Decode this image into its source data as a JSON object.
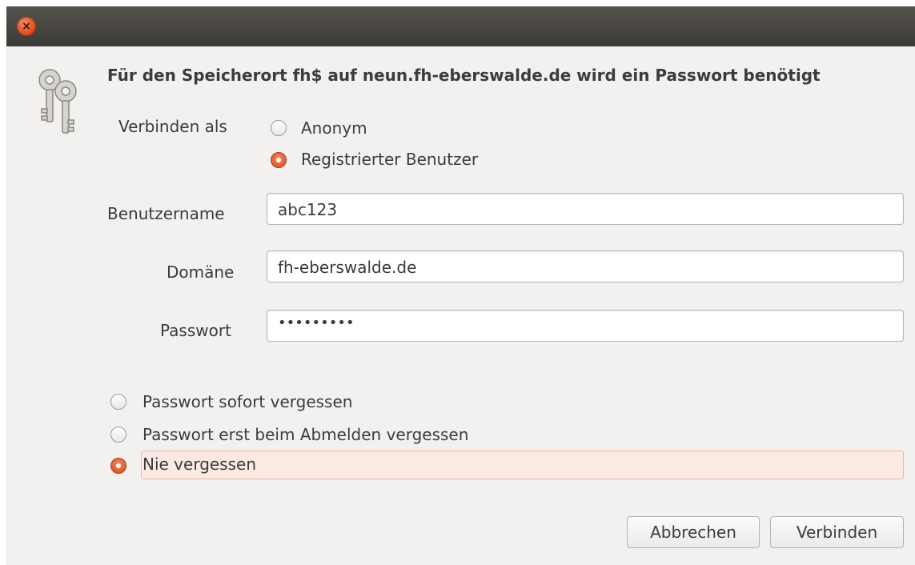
{
  "window": {
    "close_glyph": "×"
  },
  "dialog": {
    "heading": "Für den Speicherort fh$ auf neun.fh-eberswalde.de wird ein Passwort benötigt",
    "icon": "keys-icon",
    "connect_as": {
      "label": "Verbinden als",
      "options": [
        {
          "label": "Anonym",
          "checked": false
        },
        {
          "label": "Registrierter Benutzer",
          "checked": true
        }
      ]
    },
    "fields": {
      "username": {
        "label": "Benutzername",
        "value": "abc123"
      },
      "domain": {
        "label": "Domäne",
        "value": "fh-eberswalde.de"
      },
      "password": {
        "label": "Passwort",
        "value": "•••••••••"
      }
    },
    "remember": {
      "options": [
        {
          "label": "Passwort sofort vergessen",
          "checked": false
        },
        {
          "label": "Passwort erst beim Abmelden vergessen",
          "checked": false
        },
        {
          "label": "Nie vergessen",
          "checked": true
        }
      ]
    },
    "buttons": {
      "cancel": "Abbrechen",
      "connect": "Verbinden"
    }
  },
  "colors": {
    "accent": "#e1582c",
    "titlebar": "#3c3b37",
    "background": "#f2f1f0"
  }
}
